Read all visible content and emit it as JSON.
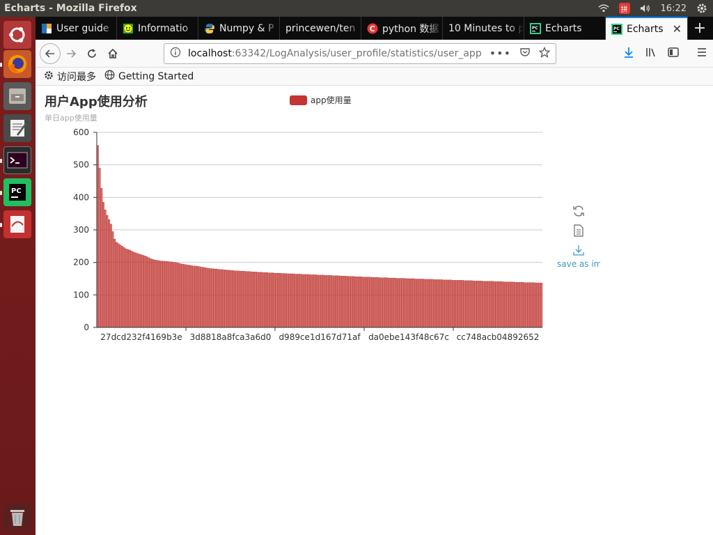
{
  "system": {
    "window_title": "Echarts - Mozilla Firefox",
    "time": "16:22",
    "input_method": "拼"
  },
  "launcher": {
    "items": [
      "ubuntu-dash",
      "firefox",
      "files",
      "text-editor",
      "terminal",
      "pycharm",
      "libreoffice-draw",
      "trash"
    ]
  },
  "tabs": [
    {
      "label": "User guide",
      "icon": "hourglass-icon"
    },
    {
      "label": "Informatio",
      "icon": "smiley-icon"
    },
    {
      "label": "Numpy & P",
      "icon": "python-icon"
    },
    {
      "label": "princewen/ten",
      "icon": "none"
    },
    {
      "label": "python 数据",
      "icon": "csdn-icon"
    },
    {
      "label": "10 Minutes to p",
      "icon": "none"
    },
    {
      "label": "Echarts",
      "icon": "pycharm-icon"
    },
    {
      "label": "Echarts",
      "icon": "pycharm-icon",
      "active": true
    }
  ],
  "navbar": {
    "url_host": "localhost",
    "url_rest": ":63342/LogAnalysis/user_profile/statistics/user_app"
  },
  "bookmarks": [
    {
      "label": "访问最多",
      "icon": "gear-icon"
    },
    {
      "label": "Getting Started",
      "icon": "globe-icon"
    }
  ],
  "chart_data": {
    "type": "bar",
    "title": "用户App使用分析",
    "ylabel": "单日app使用量",
    "legend": [
      "app使用量"
    ],
    "legend_position": "top-center",
    "color": "#c23531",
    "ylim": [
      0,
      600
    ],
    "yticks": [
      0,
      100,
      200,
      300,
      400,
      500,
      600
    ],
    "grid": true,
    "xtick_labels": [
      "27dcd232f4169b3e",
      "3d8818a8fca3a6d0",
      "d989ce1d167d71af",
      "da0ebe143f48c67c",
      "cc748acb04892652"
    ],
    "series": [
      {
        "name": "app使用量",
        "values": [
          560,
          490,
          428,
          385,
          362,
          345,
          332,
          318,
          295,
          272,
          262,
          258,
          254,
          250,
          246,
          242,
          240,
          238,
          235,
          232,
          230,
          228,
          226,
          224,
          222,
          220,
          218,
          215,
          212,
          210,
          208,
          207,
          206,
          205,
          204,
          204,
          203,
          203,
          202,
          202,
          201,
          200,
          199,
          198,
          196,
          195,
          194,
          193,
          192,
          191,
          190,
          189,
          189,
          188,
          187,
          186,
          185,
          184,
          183,
          182,
          181,
          181,
          180,
          180,
          179,
          178,
          178,
          177,
          177,
          176,
          176,
          175,
          175,
          174,
          174,
          174,
          173,
          173,
          173,
          172,
          172,
          172,
          171,
          171,
          171,
          170,
          170,
          170,
          169,
          169,
          169,
          168,
          168,
          168,
          167,
          167,
          167,
          167,
          166,
          166,
          166,
          165,
          165,
          165,
          165,
          164,
          164,
          164,
          164,
          163,
          163,
          163,
          163,
          162,
          162,
          162,
          162,
          161,
          161,
          161,
          161,
          160,
          160,
          160,
          160,
          159,
          159,
          159,
          159,
          158,
          158,
          158,
          158,
          157,
          157,
          157,
          157,
          156,
          156,
          156,
          156,
          155,
          155,
          155,
          155,
          155,
          154,
          154,
          154,
          154,
          153,
          153,
          153,
          153,
          153,
          152,
          152,
          152,
          152,
          151,
          151,
          151,
          151,
          151,
          150,
          150,
          150,
          150,
          150,
          149,
          149,
          149,
          149,
          149,
          148,
          148,
          148,
          148,
          148,
          147,
          147,
          147,
          147,
          147,
          146,
          146,
          146,
          146,
          146,
          145,
          145,
          145,
          145,
          145,
          145,
          144,
          144,
          144,
          144,
          144,
          143,
          143,
          143,
          143,
          143,
          142,
          142,
          142,
          142,
          142,
          142,
          141,
          141,
          141,
          141,
          141,
          140,
          140,
          140,
          140,
          140,
          140,
          139,
          139,
          139,
          139,
          139,
          138,
          138,
          138,
          138,
          138,
          138,
          137,
          137,
          137,
          137
        ]
      }
    ]
  },
  "toolbox": {
    "restore_icon": "refresh-icon",
    "dataview_icon": "document-icon",
    "save_icon": "download-icon",
    "save_label": "save as image"
  }
}
